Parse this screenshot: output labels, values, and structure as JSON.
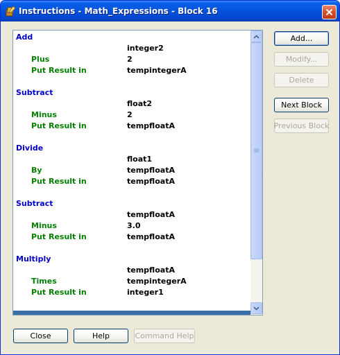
{
  "window": {
    "title": "Instructions - Math_Expressions - Block 16"
  },
  "instructions": [
    {
      "op": "Add",
      "operand": "integer2",
      "params": [
        {
          "label": "Plus",
          "value": "2"
        },
        {
          "label": "Put Result in",
          "value": "tempintegerA"
        }
      ]
    },
    {
      "op": "Subtract",
      "operand": "float2",
      "params": [
        {
          "label": "Minus",
          "value": "2"
        },
        {
          "label": "Put Result in",
          "value": "tempfloatA"
        }
      ]
    },
    {
      "op": "Divide",
      "operand": "float1",
      "params": [
        {
          "label": "By",
          "value": "tempfloatA"
        },
        {
          "label": "Put Result in",
          "value": "tempfloatA"
        }
      ]
    },
    {
      "op": "Subtract",
      "operand": "tempfloatA",
      "params": [
        {
          "label": "Minus",
          "value": "3.0"
        },
        {
          "label": "Put Result in",
          "value": "tempfloatA"
        }
      ]
    },
    {
      "op": "Multiply",
      "operand": "tempfloatA",
      "params": [
        {
          "label": "Times",
          "value": "tempintegerA"
        },
        {
          "label": "Put Result in",
          "value": "integer1"
        }
      ]
    }
  ],
  "side_buttons": {
    "add": "Add...",
    "modify": "Modify...",
    "delete": "Delete",
    "next_block": "Next Block",
    "previous_block": "Previous Block"
  },
  "bottom_buttons": {
    "close": "Close",
    "help": "Help",
    "command_help": "Command Help"
  },
  "colors": {
    "operation": "#0000c8",
    "parameter": "#008000",
    "titlebar": "#0453dd"
  }
}
